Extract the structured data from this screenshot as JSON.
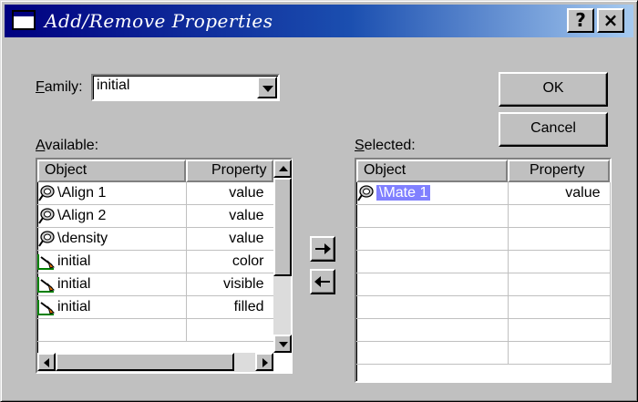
{
  "window": {
    "title": "Add/Remove Properties",
    "help_label": "?",
    "close_label": "×"
  },
  "family": {
    "label_accel": "F",
    "label_rest": "amily:",
    "value": "initial"
  },
  "buttons": {
    "ok": "OK",
    "cancel": "Cancel"
  },
  "available": {
    "label_accel": "A",
    "label_rest": "vailable:",
    "columns": [
      "Object",
      "Property"
    ],
    "rows": [
      {
        "icon": "measure-icon",
        "object": "\\Align 1",
        "property": "value"
      },
      {
        "icon": "measure-icon",
        "object": "\\Align 2",
        "property": "value"
      },
      {
        "icon": "measure-icon",
        "object": "\\density",
        "property": "value"
      },
      {
        "icon": "tool-icon",
        "object": "initial",
        "property": "color"
      },
      {
        "icon": "tool-icon",
        "object": "initial",
        "property": "visible"
      },
      {
        "icon": "tool-icon",
        "object": "initial",
        "property": "filled"
      }
    ]
  },
  "selected": {
    "label_accel": "S",
    "label_rest": "elected:",
    "columns": [
      "Object",
      "Property"
    ],
    "rows": [
      {
        "icon": "measure-icon",
        "object": "\\Mate 1",
        "property": "value"
      }
    ]
  },
  "colors": {
    "title_start": "#000080",
    "title_end": "#a6caf0",
    "face": "#c0c0c0",
    "selection": "#8080ff"
  }
}
